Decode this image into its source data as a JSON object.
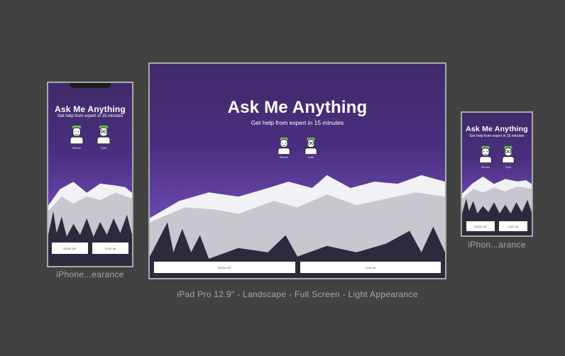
{
  "app": {
    "title": "Ask Me Anything",
    "subtitle": "Get help from expert in 15 minutes",
    "experts": [
      {
        "name": "Steven"
      },
      {
        "name": "Tyler"
      }
    ],
    "signup_label": "SIGN UP",
    "login_label": "LOG IN"
  },
  "artboards": {
    "ipad": {
      "caption": "iPad Pro 12.9\" - Landscape - Full Screen - Light Appearance"
    },
    "iphone_x": {
      "caption": "iPhone...earance"
    },
    "iphone_8": {
      "caption": "iPhon...arance"
    }
  },
  "colors": {
    "canvas": "#424242",
    "gradient_top": "#3f2a68",
    "gradient_bottom": "#7655be",
    "hair": "#6cc04a",
    "forest": "#2e2a3e",
    "button": "#ffffff"
  }
}
